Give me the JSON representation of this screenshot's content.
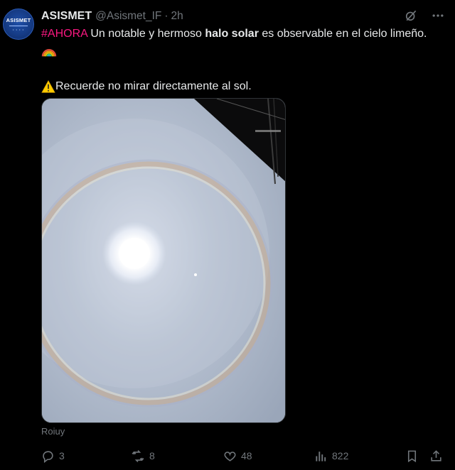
{
  "author": {
    "display_name": "ASISMET",
    "handle": "@Asismet_IF",
    "separator": "·",
    "time": "2h",
    "avatar_text": "ASISMET"
  },
  "post": {
    "hashtag": "#AHORA",
    "text_part1": " Un notable y hermoso ",
    "bold_text": "halo solar",
    "text_part2": " es observable en el cielo limeño.",
    "emoji": "🌈",
    "warning_emoji": "⚠️",
    "warning_text": "Recuerde no mirar directamente al sol."
  },
  "media": {
    "description_icon": "solar-halo-photo",
    "credit": "Roiuy"
  },
  "actions": {
    "replies": "3",
    "reposts": "8",
    "likes": "48",
    "views": "822"
  },
  "icons": {
    "grok": "grok-icon",
    "more": "more-options-icon",
    "reply": "reply-icon",
    "repost": "repost-icon",
    "like": "heart-icon",
    "views": "views-chart-icon",
    "bookmark": "bookmark-icon",
    "share": "share-icon"
  },
  "colors": {
    "background": "#000000",
    "text": "#e7e9ea",
    "muted": "#71767b",
    "hashtag": "#f91880"
  }
}
